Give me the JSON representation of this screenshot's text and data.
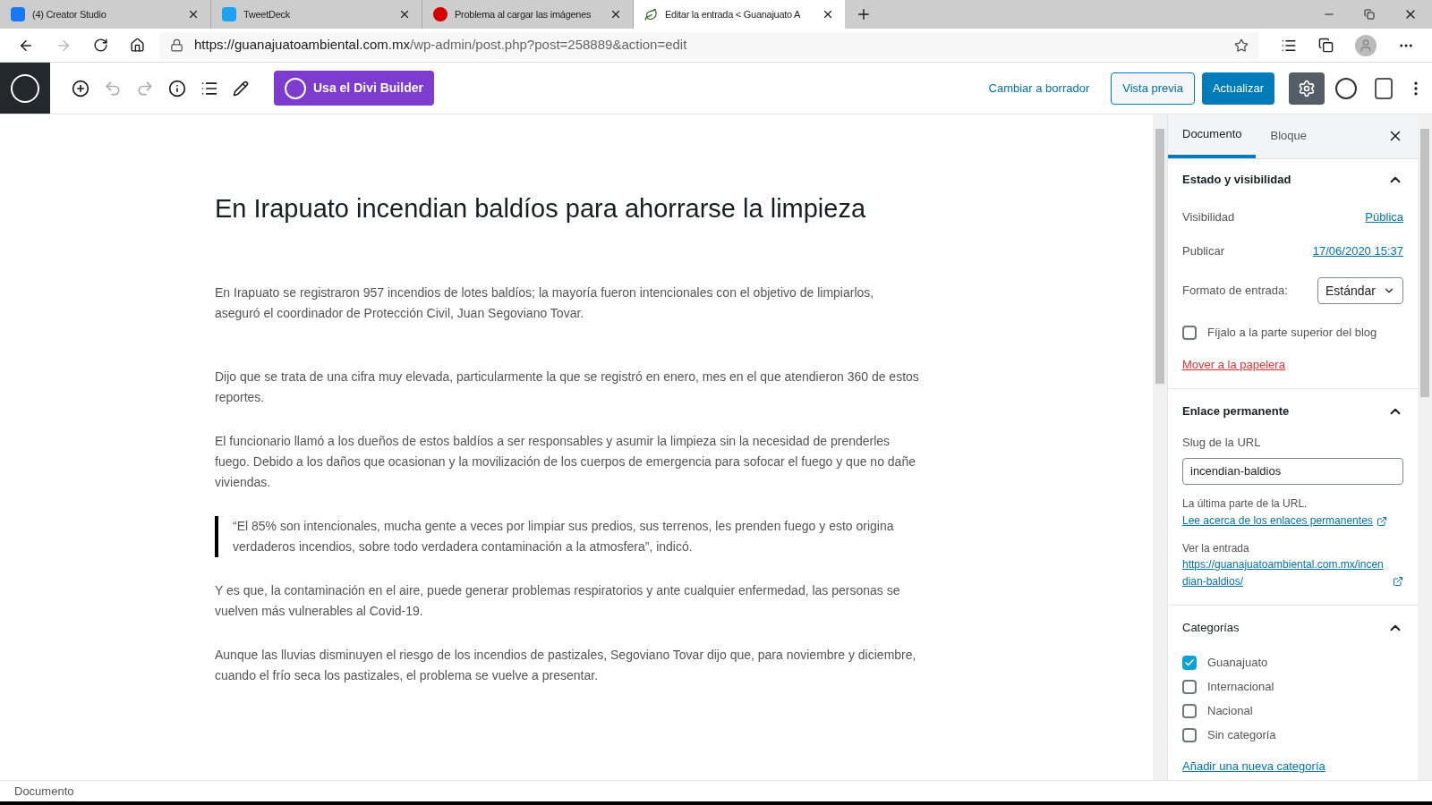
{
  "browser": {
    "tabs": [
      {
        "title": "(4) Creator Studio",
        "selected": false
      },
      {
        "title": "TweetDeck",
        "selected": false
      },
      {
        "title": "Problema al cargar las imágenes",
        "selected": false
      },
      {
        "title": "Editar la entrada < Guanajuato A",
        "selected": true
      }
    ],
    "url_host": "https://guanajuatoambiental.com.mx",
    "url_path": "/wp-admin/post.php?post=258889&action=edit"
  },
  "toolbar": {
    "divi_button": "Usa el Divi Builder",
    "switch_draft": "Cambiar a borrador",
    "preview": "Vista previa",
    "update": "Actualizar",
    "settings_active": true
  },
  "post": {
    "title": "En Irapuato incendian baldíos para ahorrarse la limpieza",
    "blocks": [
      {
        "kind": "paragraph",
        "text": "En Irapuato se registraron 957 incendios de lotes baldíos; la mayoría fueron intencionales con el objetivo de limpiarlos, aseguró el coordinador de Protección Civil, Juan Segoviano Tovar."
      },
      {
        "kind": "spacer"
      },
      {
        "kind": "paragraph",
        "text": "Dijo que se trata de una cifra muy elevada, particularmente la que se registró en enero, mes en el que atendieron 360 de estos reportes."
      },
      {
        "kind": "paragraph",
        "text": "El funcionario llamó a los dueños de estos baldíos a ser responsables y asumir la limpieza sin la necesidad de prenderles fuego. Debido a los daños que ocasionan y la movilización de los cuerpos de emergencia para sofocar el fuego y que no dañe viviendas."
      },
      {
        "kind": "quote",
        "text": "“El 85% son intencionales, mucha gente a veces por limpiar sus predios, sus terrenos, les prenden fuego y esto origina verdaderos incendios, sobre todo verdadera contaminación a la atmosfera”, indicó."
      },
      {
        "kind": "paragraph",
        "text": "Y es que, la contaminación en el aire, puede generar problemas respiratorios y ante cualquier enfermedad, las personas se vuelven más vulnerables al Covid-19."
      },
      {
        "kind": "paragraph",
        "text": "Aunque las lluvias disminuyen el riesgo de los incendios de pastizales, Segoviano Tovar dijo que, para noviembre y diciembre, cuando el frío seca los pastizales, el problema se vuelve a presentar."
      }
    ]
  },
  "sidebar": {
    "tabs": [
      {
        "label": "Documento",
        "selected": true
      },
      {
        "label": "Bloque",
        "selected": false
      }
    ],
    "status": {
      "title": "Estado y visibilidad",
      "expanded": true,
      "visibility_label": "Visibilidad",
      "visibility_value": "Pública",
      "publish_label": "Publicar",
      "publish_value": "17/06/2020 15:37",
      "format_label": "Formato de entrada:",
      "format_value": "Estándar",
      "sticky_label": "Fíjalo a la parte superior del blog",
      "sticky": false,
      "trash": "Mover a la papelera"
    },
    "permalink": {
      "title": "Enlace permanente",
      "expanded": true,
      "slug_label": "Slug de la URL",
      "slug": "incendian-baldios",
      "help": "La última parte de la URL.",
      "help_link": "Lee acerca de los enlaces permanentes",
      "view_label": "Ver la entrada",
      "view_link": "https://guanajuatoambiental.com.mx/incendian-baldios/"
    },
    "categories": {
      "title": "Categorías",
      "expanded": true,
      "items": [
        {
          "label": "Guanajuato",
          "checked": true
        },
        {
          "label": "Internacional",
          "checked": false
        },
        {
          "label": "Nacional",
          "checked": false
        },
        {
          "label": "Sin categoría",
          "checked": false
        }
      ],
      "add": "Añadir una nueva categoría"
    }
  },
  "footer": {
    "breadcrumb": "Documento"
  }
}
